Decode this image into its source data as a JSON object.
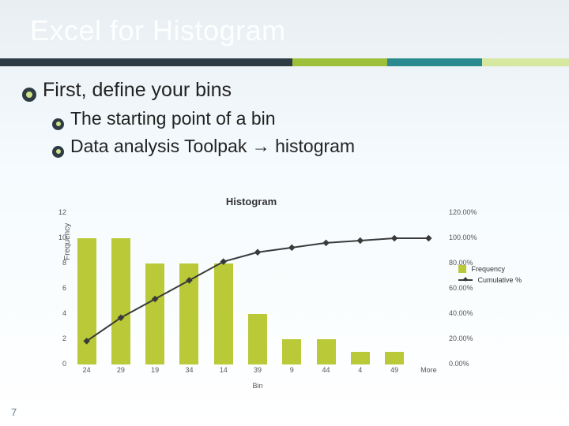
{
  "title": "Excel for Histogram",
  "bullets": {
    "l1": "First, define your bins",
    "s1": "The starting point of a bin",
    "s2a": "Data analysis Toolpak ",
    "s2arrow": "→",
    "s2b": " histogram"
  },
  "page_number": "7",
  "legend": {
    "freq": "Frequency",
    "cum": "Cumulative %"
  },
  "chart_data": {
    "type": "bar",
    "title": "Histogram",
    "xlabel": "Bin",
    "ylabel": "Frequency",
    "categories": [
      "24",
      "29",
      "19",
      "34",
      "14",
      "39",
      "9",
      "44",
      "4",
      "49",
      "More"
    ],
    "y_left_ticks": [
      "0",
      "2",
      "4",
      "6",
      "8",
      "10",
      "12"
    ],
    "y_right_ticks": [
      "0.00%",
      "20.00%",
      "40.00%",
      "60.00%",
      "80.00%",
      "100.00%",
      "120.00%"
    ],
    "ylim_left": [
      0,
      12
    ],
    "ylim_right": [
      0,
      120
    ],
    "series": [
      {
        "name": "Frequency",
        "type": "bar",
        "values": [
          10,
          10,
          8,
          8,
          8,
          4,
          2,
          2,
          1,
          1,
          0
        ]
      },
      {
        "name": "Cumulative %",
        "type": "line",
        "values": [
          18.52,
          37.04,
          51.85,
          66.67,
          81.48,
          88.89,
          92.59,
          96.3,
          98.15,
          100.0,
          100.0
        ]
      }
    ]
  }
}
